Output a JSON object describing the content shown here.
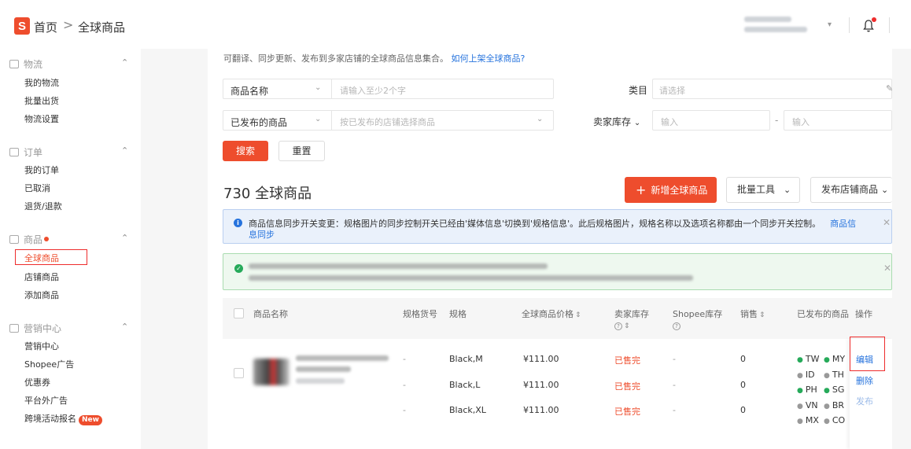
{
  "header": {
    "logo_letter": "S",
    "breadcrumb_home": "首页",
    "breadcrumb_sep": ">",
    "breadcrumb_current": "全球商品",
    "bell_icon": "bell-icon",
    "accent": "#ee4d2d"
  },
  "sidebar": {
    "sections": [
      {
        "label": "物流",
        "items": [
          "我的物流",
          "批量出货",
          "物流设置"
        ]
      },
      {
        "label": "订单",
        "items": [
          "我的订单",
          "已取消",
          "退货/退款"
        ]
      },
      {
        "label": "商品",
        "items": [
          "全球商品",
          "店铺商品",
          "添加商品"
        ]
      },
      {
        "label": "营销中心",
        "items": [
          "营销中心",
          "Shopee广告",
          "优惠券",
          "平台外广告",
          "跨境活动报名"
        ]
      }
    ],
    "new_badge": "New"
  },
  "intro": {
    "text": "可翻译、同步更新、发布到多家店铺的全球商品信息集合。",
    "link": "如何上架全球商品?"
  },
  "filters": {
    "name_select": "商品名称",
    "name_placeholder": "请输入至少2个字",
    "category_label": "类目",
    "category_placeholder": "请选择",
    "published_select": "已发布的商品",
    "shop_placeholder": "按已发布的店铺选择商品",
    "stock_label": "卖家库存",
    "min_placeholder": "输入",
    "range_sep": "-",
    "max_placeholder": "输入",
    "search_button": "搜索",
    "reset_button": "重置"
  },
  "toolbar": {
    "count_title": "730 全球商品",
    "add_button": "新增全球商品",
    "batch_button": "批量工具",
    "publish_button": "发布店铺商品"
  },
  "notice": {
    "text": "商品信息同步开关变更：规格图片的同步控制开关已经由'媒体信息'切换到'规格信息'。此后规格图片，规格名称以及选项名称都由一个同步开关控制。",
    "link": "商品信",
    "text2": "息同步"
  },
  "table": {
    "headers": {
      "name": "商品名称",
      "sku": "规格货号",
      "variation": "规格",
      "price": "全球商品价格",
      "seller_stock": "卖家库存",
      "shopee_stock": "Shopee库存",
      "sales": "销售",
      "published": "已发布的商品",
      "actions": "操作"
    },
    "rows": [
      {
        "sku": "-",
        "variation": "Black,M",
        "price": "¥111.00",
        "stock": "已售完",
        "shopee_stock": "-",
        "sales": "0"
      },
      {
        "sku": "-",
        "variation": "Black,L",
        "price": "¥111.00",
        "stock": "已售完",
        "shopee_stock": "-",
        "sales": "0"
      },
      {
        "sku": "-",
        "variation": "Black,XL",
        "price": "¥111.00",
        "stock": "已售完",
        "shopee_stock": "-",
        "sales": "0"
      }
    ],
    "markets": [
      "TW",
      "MY",
      "ID",
      "TH",
      "PH",
      "SG",
      "VN",
      "BR",
      "MX",
      "CO"
    ],
    "actions": {
      "edit": "编辑",
      "delete": "删除",
      "publish": "发布"
    }
  }
}
